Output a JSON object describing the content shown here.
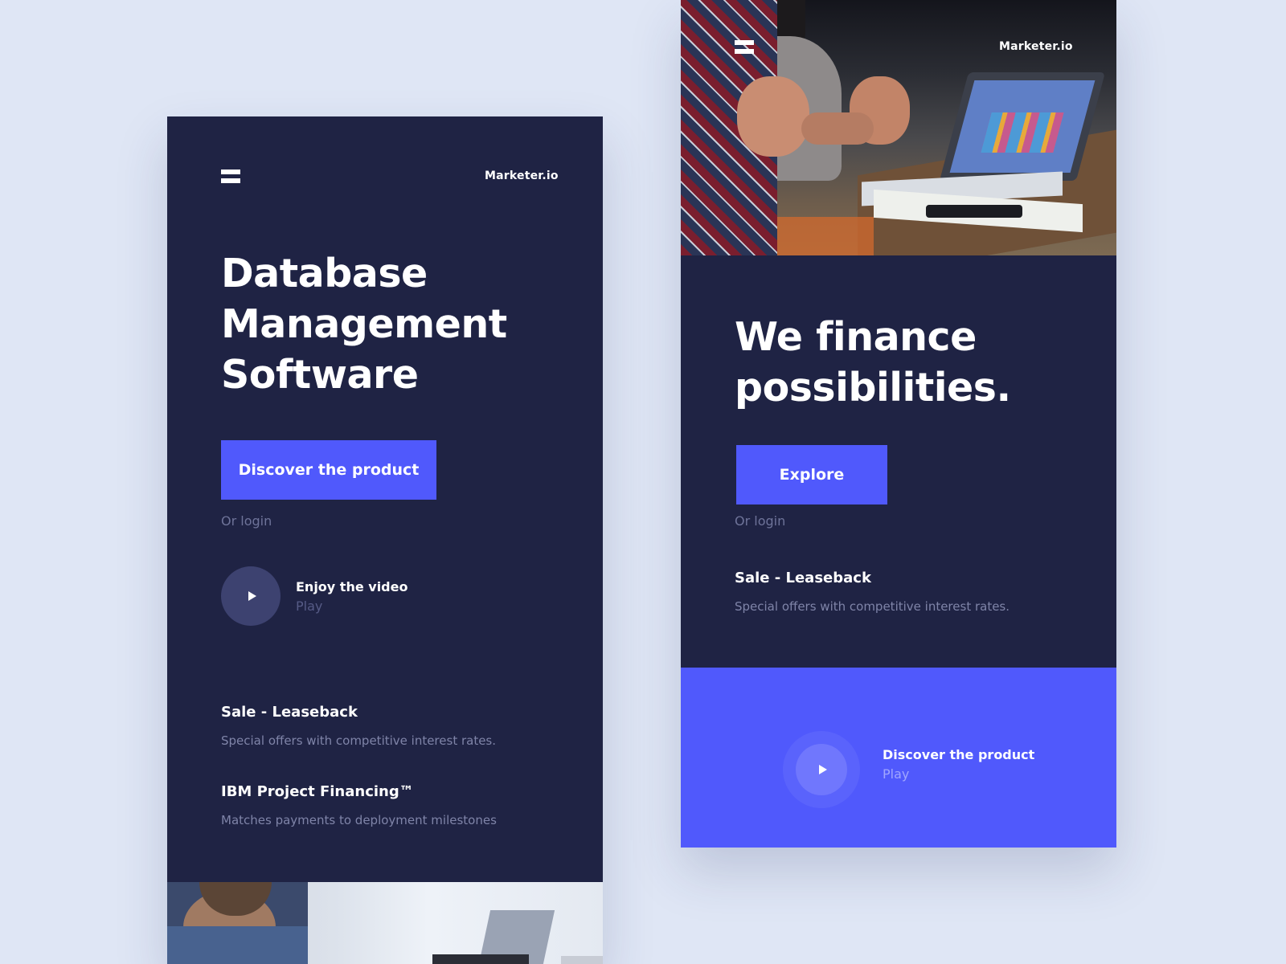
{
  "colors": {
    "background": "#dfe6f5",
    "panel": "#1f2344",
    "accent": "#5059fc",
    "muted_text": "#6e7399"
  },
  "left_screen": {
    "brand": "Marketer.io",
    "menu_icon": "hamburger-icon",
    "headline_lines": [
      "Database",
      "Management",
      "Software"
    ],
    "cta_label": "Discover the product",
    "login_text": "Or login",
    "video": {
      "icon": "play-icon",
      "title": "Enjoy the video",
      "subtitle": "Play"
    },
    "features": [
      {
        "title": "Sale - Leaseback",
        "description": "Special offers with competitive interest rates."
      },
      {
        "title": "IBM Project Financing™",
        "description": "Matches payments to deployment milestones"
      }
    ]
  },
  "right_screen": {
    "brand": "Marketer.io",
    "menu_icon": "hamburger-icon",
    "headline_lines": [
      "We finance",
      "possibilities."
    ],
    "cta_label": "Explore",
    "login_text": "Or login",
    "feature": {
      "title": "Sale - Leaseback",
      "description": "Special offers with competitive interest rates."
    },
    "video": {
      "icon": "play-icon",
      "title": "Discover the product",
      "subtitle": "Play"
    }
  }
}
